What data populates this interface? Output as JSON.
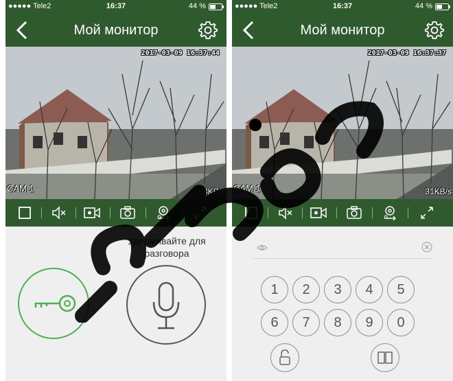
{
  "status": {
    "carrier": "●●●●● Tele2",
    "time": "16:37",
    "battery": "44 %",
    "battery_level": 0.44
  },
  "screens": [
    {
      "title": "Мой монитор",
      "video": {
        "timestamp": "2017-03-09  16:37:44",
        "camera": "CAM 1",
        "bitrate": "63KB/s"
      },
      "hold_to_talk": "Удерживайте для разговора"
    },
    {
      "title": "Мой монитор",
      "video": {
        "timestamp": "2017-03-09  16:37:37",
        "camera": "CAM 1",
        "bitrate": "31KB/s"
      },
      "keypad": [
        "1",
        "2",
        "3",
        "4",
        "5",
        "6",
        "7",
        "8",
        "9",
        "0"
      ]
    }
  ],
  "icons": {
    "toolbar": [
      "stop-icon",
      "mute-icon",
      "record-icon",
      "snapshot-icon",
      "switch-camera-icon",
      "fullscreen-icon"
    ],
    "accent": "#2f5a2d",
    "key_green": "#4caf50"
  }
}
